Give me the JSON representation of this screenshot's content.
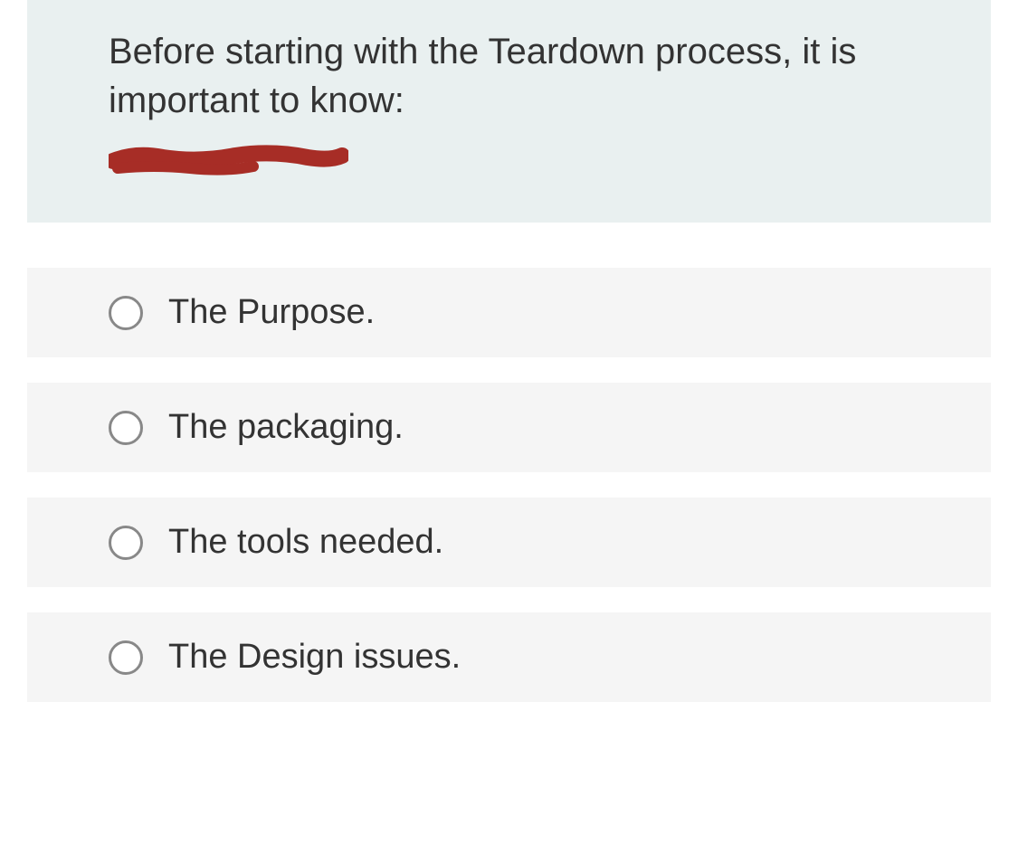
{
  "question": {
    "text": "Before starting with the Teardown process, it is important to know:"
  },
  "options": [
    {
      "label": "The Purpose."
    },
    {
      "label": "The packaging."
    },
    {
      "label": "The tools needed."
    },
    {
      "label": "The Design issues."
    }
  ]
}
